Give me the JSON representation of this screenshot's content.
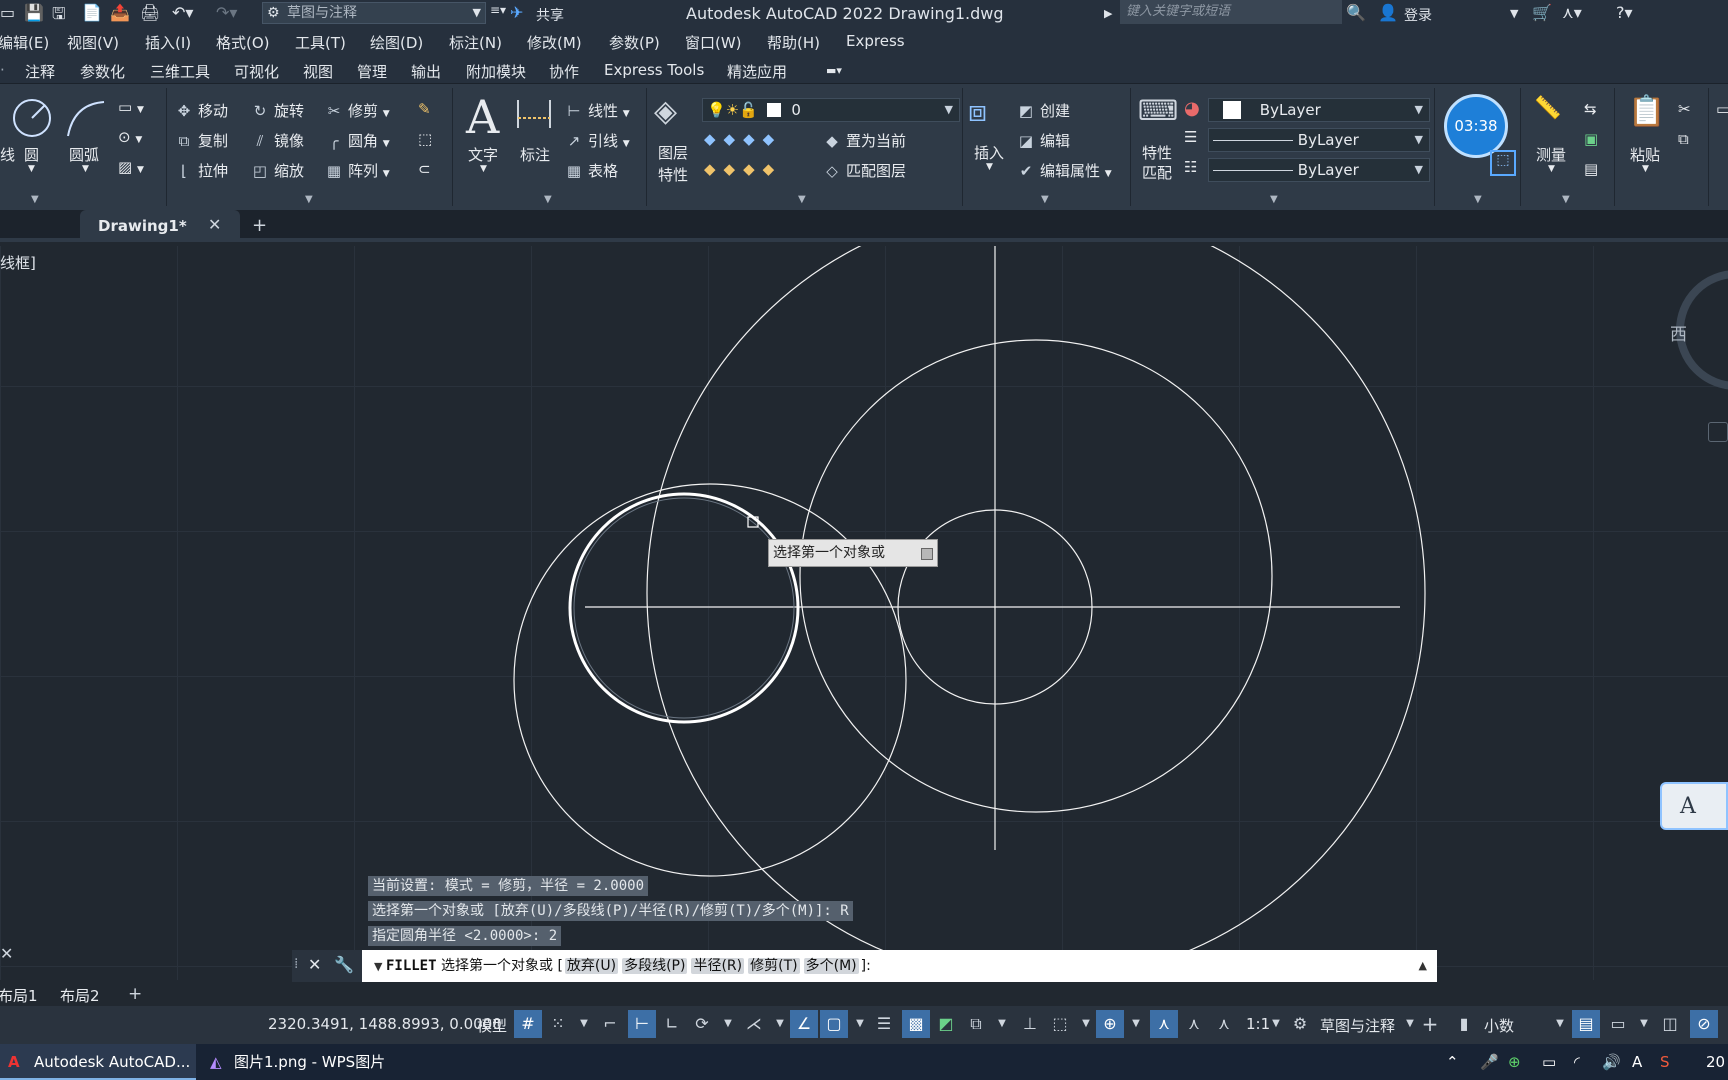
{
  "title_bar": {
    "workspace": "草图与注释",
    "share": "共享",
    "title": "Autodesk AutoCAD 2022    Drawing1.dwg",
    "search_placeholder": "键入关键字或短语",
    "login": "登录"
  },
  "menu": [
    "编辑(E)",
    "视图(V)",
    "插入(I)",
    "格式(O)",
    "工具(T)",
    "绘图(D)",
    "标注(N)",
    "修改(M)",
    "参数(P)",
    "窗口(W)",
    "帮助(H)",
    "Express"
  ],
  "ribbon_tabs": [
    "注释",
    "参数化",
    "三维工具",
    "可视化",
    "视图",
    "管理",
    "输出",
    "附加模块",
    "协作",
    "Express Tools",
    "精选应用"
  ],
  "ribbon": {
    "draw": {
      "circle": "圆",
      "arc": "圆弧",
      "line_partial": "线"
    },
    "modify": {
      "move": "移动",
      "rotate": "旋转",
      "trim": "修剪",
      "copy": "复制",
      "mirror": "镜像",
      "fillet": "圆角",
      "stretch": "拉伸",
      "scale": "缩放",
      "array": "阵列"
    },
    "annotation": {
      "text": "文字",
      "dimension": "标注",
      "linear": "线性",
      "leader": "引线",
      "table": "表格"
    },
    "layers": {
      "layer_properties_1": "图层",
      "layer_properties_2": "特性",
      "current_layer": "0",
      "set_current": "置为当前",
      "match_layer": "匹配图层"
    },
    "block": {
      "insert": "插入",
      "create": "创建",
      "edit": "编辑",
      "edit_attributes": "编辑属性"
    },
    "properties": {
      "match_1": "特性",
      "match_2": "匹配",
      "color": "ByLayer",
      "linetype": "ByLayer",
      "lineweight": "ByLayer"
    },
    "timer": "03:38",
    "utilities": {
      "measure": "测量"
    },
    "clipboard": {
      "paste": "粘贴"
    }
  },
  "doc_tabs": {
    "active": "Drawing1*"
  },
  "viewport_label": "线框]",
  "viewcube_label": "西",
  "tooltip": "选择第一个对象或",
  "command_history": [
    "当前设置: 模式 = 修剪，半径 = 2.0000",
    "选择第一个对象或 [放弃(U)/多段线(P)/半径(R)/修剪(T)/多个(M)]: R",
    "指定圆角半径 <2.0000>: 2"
  ],
  "command_line": {
    "command": "FILLET",
    "prompt": "选择第一个对象或 [",
    "options": [
      "放弃(U)",
      "多段线(P)",
      "半径(R)",
      "修剪(T)",
      "多个(M)"
    ],
    "suffix": "]:"
  },
  "layout_tabs": [
    "布局1",
    "布局2"
  ],
  "status_bar": {
    "coordinates": "2320.3491, 1488.8993, 0.0000",
    "model": "模型",
    "scale": "1:1",
    "workspace": "草图与注释",
    "units": "小数"
  },
  "taskbar": {
    "apps": [
      "Autodesk AutoCAD...",
      "图片1.png - WPS图片"
    ],
    "clock_partial": "20"
  },
  "colors": {
    "accent": "#3d6fa6",
    "canvas": "#212830",
    "ribbon": "#2f3a47",
    "timer": "#1e7fd8"
  }
}
